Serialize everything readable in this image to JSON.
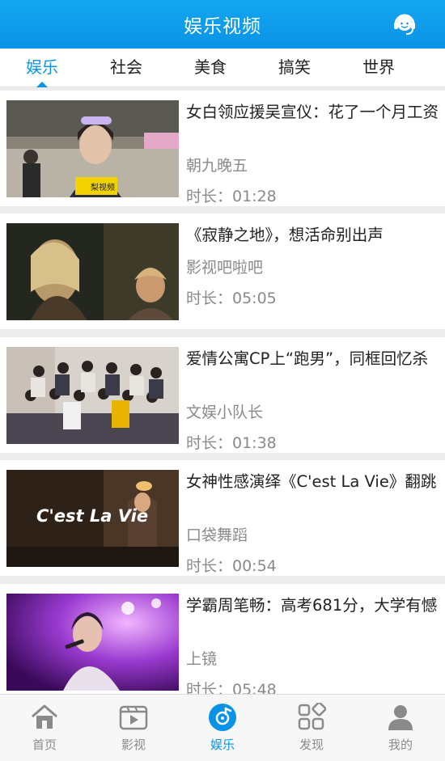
{
  "header": {
    "title": "娱乐视频"
  },
  "tabs": [
    {
      "label": "娱乐",
      "active": true
    },
    {
      "label": "社会",
      "active": false
    },
    {
      "label": "美食",
      "active": false
    },
    {
      "label": "搞笑",
      "active": false
    },
    {
      "label": "世界",
      "active": false
    }
  ],
  "videos": [
    {
      "title": "女白领应援吴宣仪：花了一个月工资",
      "author": "朝九晚五",
      "duration": "时长：01:28",
      "badge": "梨视频",
      "thumb_colors": [
        "#6f6a60",
        "#cfc6b8"
      ]
    },
    {
      "title": "《寂静之地》，想活命别出声",
      "author": "影视吧啦吧",
      "duration": "时长：05:05",
      "badge": "",
      "thumb_colors": [
        "#2b2f2b",
        "#7a6e52"
      ]
    },
    {
      "title": "爱情公寓CP上“跑男”，同框回忆杀",
      "author": "文娱小队长",
      "duration": "时长：01:38",
      "badge": "",
      "thumb_colors": [
        "#d9d4cf",
        "#6e5d55"
      ]
    },
    {
      "title": "女神性感演绎《C'est La Vie》翻跳",
      "author": "口袋舞蹈",
      "duration": "时长：00:54",
      "badge": "C'est La Vie",
      "thumb_colors": [
        "#3a2a1e",
        "#8a6a4a"
      ]
    },
    {
      "title": "学霸周笔畅：高考681分，大学有憾",
      "author": "上镜",
      "duration": "时长：05:48",
      "badge": "",
      "thumb_colors": [
        "#5b1a8a",
        "#d07ae8"
      ]
    }
  ],
  "bottom_nav": [
    {
      "label": "首页",
      "icon": "home-icon",
      "active": false
    },
    {
      "label": "影视",
      "icon": "film-icon",
      "active": false
    },
    {
      "label": "娱乐",
      "icon": "music-disc-icon",
      "active": true
    },
    {
      "label": "发现",
      "icon": "discover-grid-icon",
      "active": false
    },
    {
      "label": "我的",
      "icon": "user-icon",
      "active": false
    }
  ],
  "colors": {
    "accent": "#0a93e6",
    "header": "#12a6f0",
    "muted": "#8a8a8a",
    "divider": "#ececec"
  }
}
